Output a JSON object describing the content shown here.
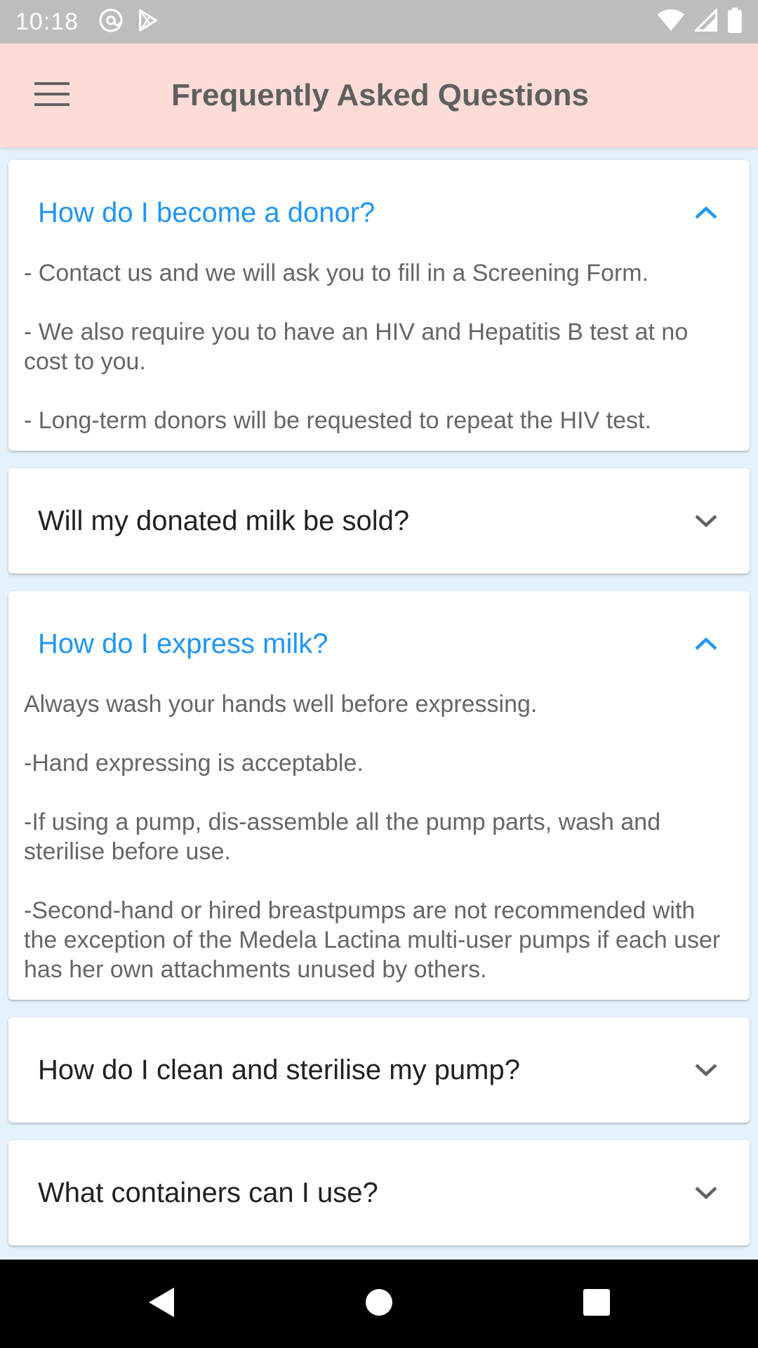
{
  "status_bar": {
    "time": "10:18",
    "left_icons": [
      "at-sign-icon",
      "play-store-icon"
    ],
    "right_icons": [
      "wifi-icon",
      "signal-icon",
      "battery-icon"
    ]
  },
  "app_bar": {
    "menu_icon": "hamburger-menu-icon",
    "title": "Frequently Asked Questions",
    "background": "#fddcd8"
  },
  "colors": {
    "accent": "#2196f3",
    "page_background": "#e5f1fb"
  },
  "faq": [
    {
      "question": "How do I become a donor?",
      "expanded": true,
      "answer": [
        "- Contact us and we will ask you to fill in a Screening Form.",
        "- We also require you to have an HIV and Hepatitis B test at no cost to you.",
        "- Long-term donors will be requested to repeat the HIV test."
      ]
    },
    {
      "question": "Will my donated milk be sold?",
      "expanded": false
    },
    {
      "question": "How do I express milk?",
      "expanded": true,
      "answer": [
        "Always wash your hands well before expressing.",
        "-Hand expressing is acceptable.",
        "-If using a pump, dis-assemble all the pump parts, wash and sterilise before use.",
        "-Second-hand or hired breastpumps are not recommended with the exception of the Medela Lactina multi-user pumps if each user has her own attachments unused by others."
      ]
    },
    {
      "question": "How do I clean and sterilise my pump?",
      "expanded": false
    },
    {
      "question": "What containers can I use?",
      "expanded": false
    }
  ],
  "nav_bar": {
    "buttons": [
      "back-icon",
      "home-icon",
      "recents-icon"
    ]
  }
}
